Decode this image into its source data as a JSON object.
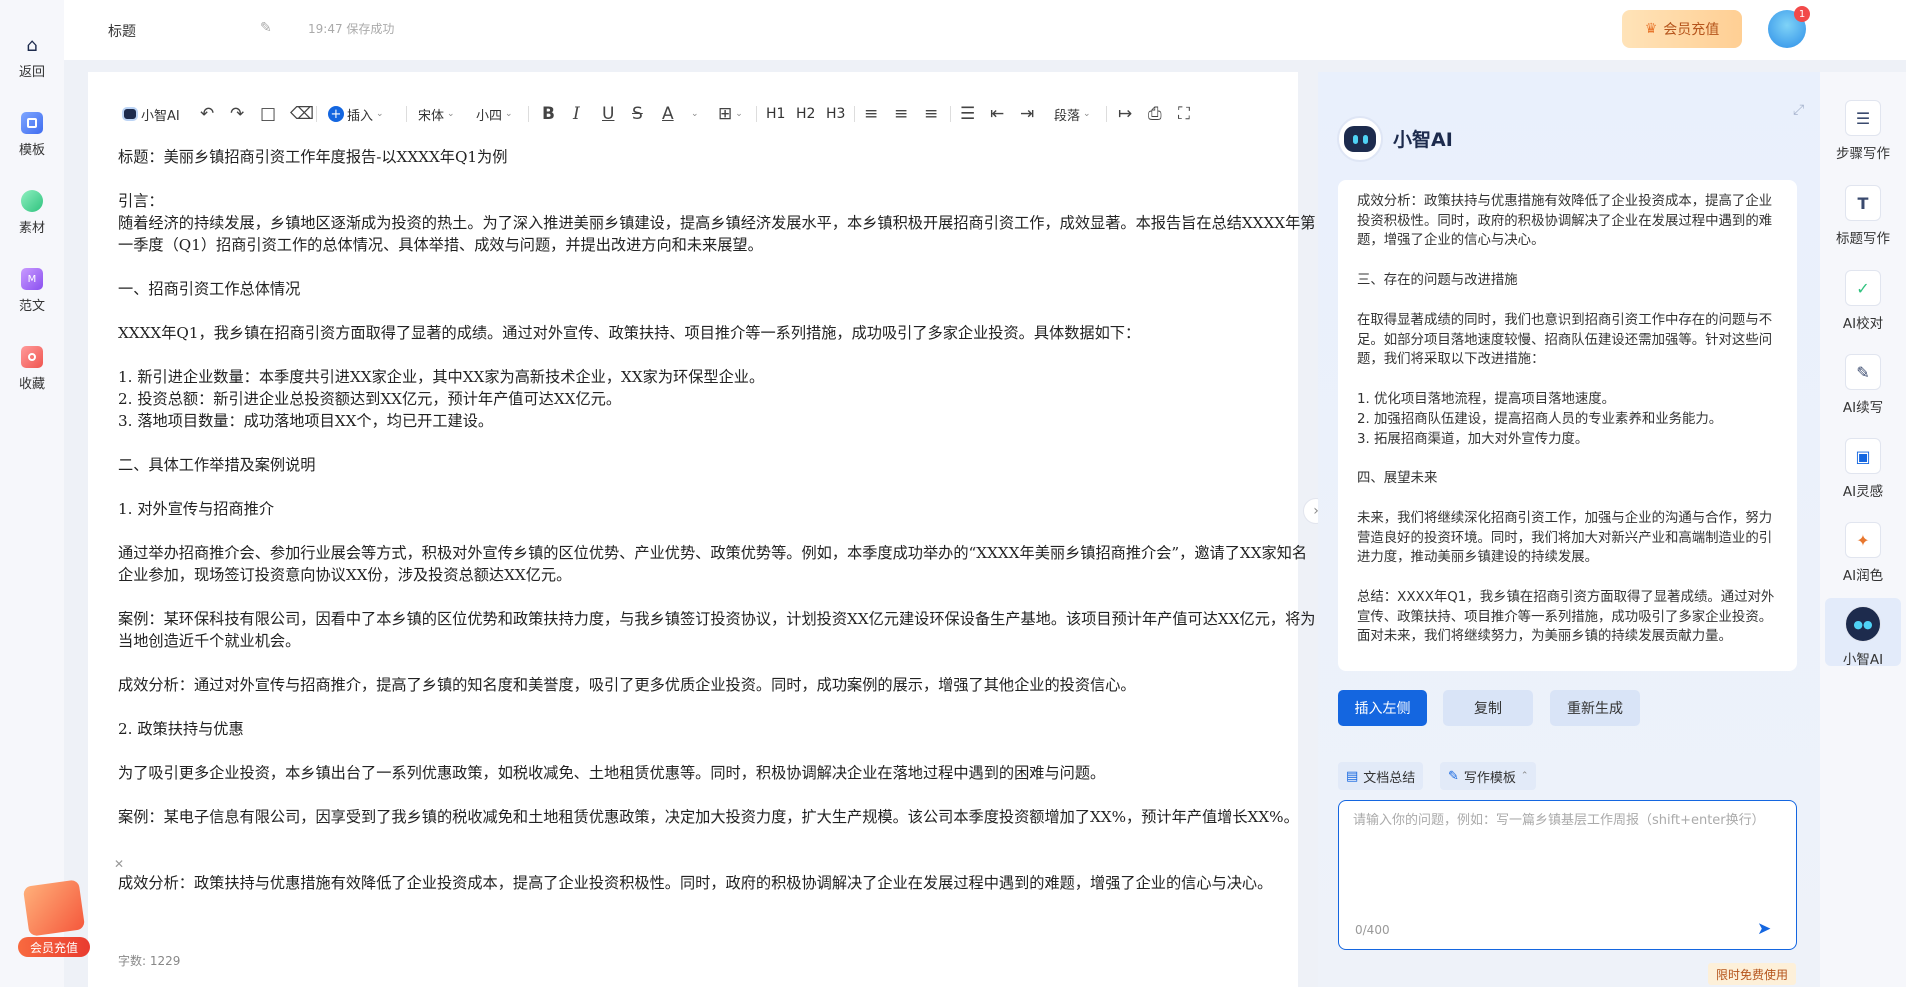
{
  "colors": {
    "accent": "#1466e0",
    "vip": "#b5541b"
  },
  "nav": [
    {
      "label": "返回",
      "icon": "home-icon"
    },
    {
      "label": "模板",
      "icon": "template-icon"
    },
    {
      "label": "素材",
      "icon": "material-icon"
    },
    {
      "label": "范文",
      "icon": "sample-icon"
    },
    {
      "label": "收藏",
      "icon": "favorite-icon"
    }
  ],
  "topbar": {
    "title": "标题",
    "save_status": "19:47 保存成功",
    "vip_label": "会员充值",
    "notification_count": "1"
  },
  "toolbar": {
    "ai_label": "小智AI",
    "insert_label": "插入",
    "font_family": "宋体",
    "font_size": "小四",
    "h1": "H1",
    "h2": "H2",
    "h3": "H3",
    "paragraph_label": "段落"
  },
  "document": {
    "paragraphs": [
      "标题：美丽乡镇招商引资工作年度报告-以XXXX年Q1为例",
      "引言：",
      "随着经济的持续发展，乡镇地区逐渐成为投资的热土。为了深入推进美丽乡镇建设，提高乡镇经济发展水平，本乡镇积极开展招商引资工作，成效显著。本报告旨在总结XXXX年第一季度（Q1）招商引资工作的总体情况、具体举措、成效与问题，并提出改进方向和未来展望。",
      "一、招商引资工作总体情况",
      "XXXX年Q1，我乡镇在招商引资方面取得了显著的成绩。通过对外宣传、政策扶持、项目推介等一系列措施，成功吸引了多家企业投资。具体数据如下：",
      "1. 新引进企业数量：本季度共引进XX家企业，其中XX家为高新技术企业，XX家为环保型企业。",
      "2. 投资总额：新引进企业总投资额达到XX亿元，预计年产值可达XX亿元。",
      "3. 落地项目数量：成功落地项目XX个，均已开工建设。",
      "二、具体工作举措及案例说明",
      "1. 对外宣传与招商推介",
      "通过举办招商推介会、参加行业展会等方式，积极对外宣传乡镇的区位优势、产业优势、政策优势等。例如，本季度成功举办的“XXXX年美丽乡镇招商推介会”，邀请了XX家知名企业参加，现场签订投资意向协议XX份，涉及投资总额达XX亿元。",
      "案例：某环保科技有限公司，因看中了本乡镇的区位优势和政策扶持力度，与我乡镇签订投资协议，计划投资XX亿元建设环保设备生产基地。该项目预计年产值可达XX亿元，将为当地创造近千个就业机会。",
      "成效分析：通过对外宣传与招商推介，提高了乡镇的知名度和美誉度，吸引了更多优质企业投资。同时，成功案例的展示，增强了其他企业的投资信心。",
      "2. 政策扶持与优惠",
      "为了吸引更多企业投资，本乡镇出台了一系列优惠政策，如税收减免、土地租赁优惠等。同时，积极协调解决企业在落地过程中遇到的困难与问题。",
      "案例：某电子信息有限公司，因享受到了我乡镇的税收减免和土地租赁优惠政策，决定加大投资力度，扩大生产规模。该公司本季度投资额增加了XX%，预计年产值增长XX%。",
      "成效分析：政策扶持与优惠措施有效降低了企业投资成本，提高了企业投资积极性。同时，政府的积极协调解决了企业在发展过程中遇到的难题，增强了企业的信心与决心。"
    ],
    "word_count": "字数: 1229"
  },
  "ai": {
    "name": "小智AI",
    "reply": [
      "成效分析：政策扶持与优惠措施有效降低了企业投资成本，提高了企业投资积极性。同时，政府的积极协调解决了企业在发展过程中遇到的难题，增强了企业的信心与决心。",
      "三、存在的问题与改进措施",
      "在取得显著成绩的同时，我们也意识到招商引资工作中存在的问题与不足。如部分项目落地速度较慢、招商队伍建设还需加强等。针对这些问题，我们将采取以下改进措施：",
      "1. 优化项目落地流程，提高项目落地速度。",
      "2. 加强招商队伍建设，提高招商人员的专业素养和业务能力。",
      "3. 拓展招商渠道，加大对外宣传力度。",
      "四、展望未来",
      "未来，我们将继续深化招商引资工作，加强与企业的沟通与合作，努力营造良好的投资环境。同时，我们将加大对新兴产业和高端制造业的引进力度，推动美丽乡镇建设的持续发展。",
      "总结：XXXX年Q1，我乡镇在招商引资方面取得了显著成绩。通过对外宣传、政策扶持、项目推介等一系列措施，成功吸引了多家企业投资。面对未来，我们将继续努力，为美丽乡镇的持续发展贡献力量。"
    ],
    "insert_left": "插入左侧",
    "copy": "复制",
    "regenerate": "重新生成",
    "chip_summary": "文档总结",
    "chip_template": "写作模板",
    "input_placeholder": "请输入你的问题，例如：写一篇乡镇基层工作周报（shift+enter换行）",
    "input_value": "",
    "char_count": "0/400",
    "free_tag": "限时免费使用"
  },
  "rail": [
    {
      "label": "步骤写作",
      "icon": "step-writing-icon"
    },
    {
      "label": "标题写作",
      "icon": "title-writing-icon"
    },
    {
      "label": "AI校对",
      "icon": "proofread-icon"
    },
    {
      "label": "AI续写",
      "icon": "continue-writing-icon"
    },
    {
      "label": "AI灵感",
      "icon": "inspiration-icon"
    },
    {
      "label": "AI润色",
      "icon": "polish-icon"
    },
    {
      "label": "小智AI",
      "icon": "ai-assistant-icon"
    }
  ],
  "promo": {
    "label": "会员充值"
  }
}
